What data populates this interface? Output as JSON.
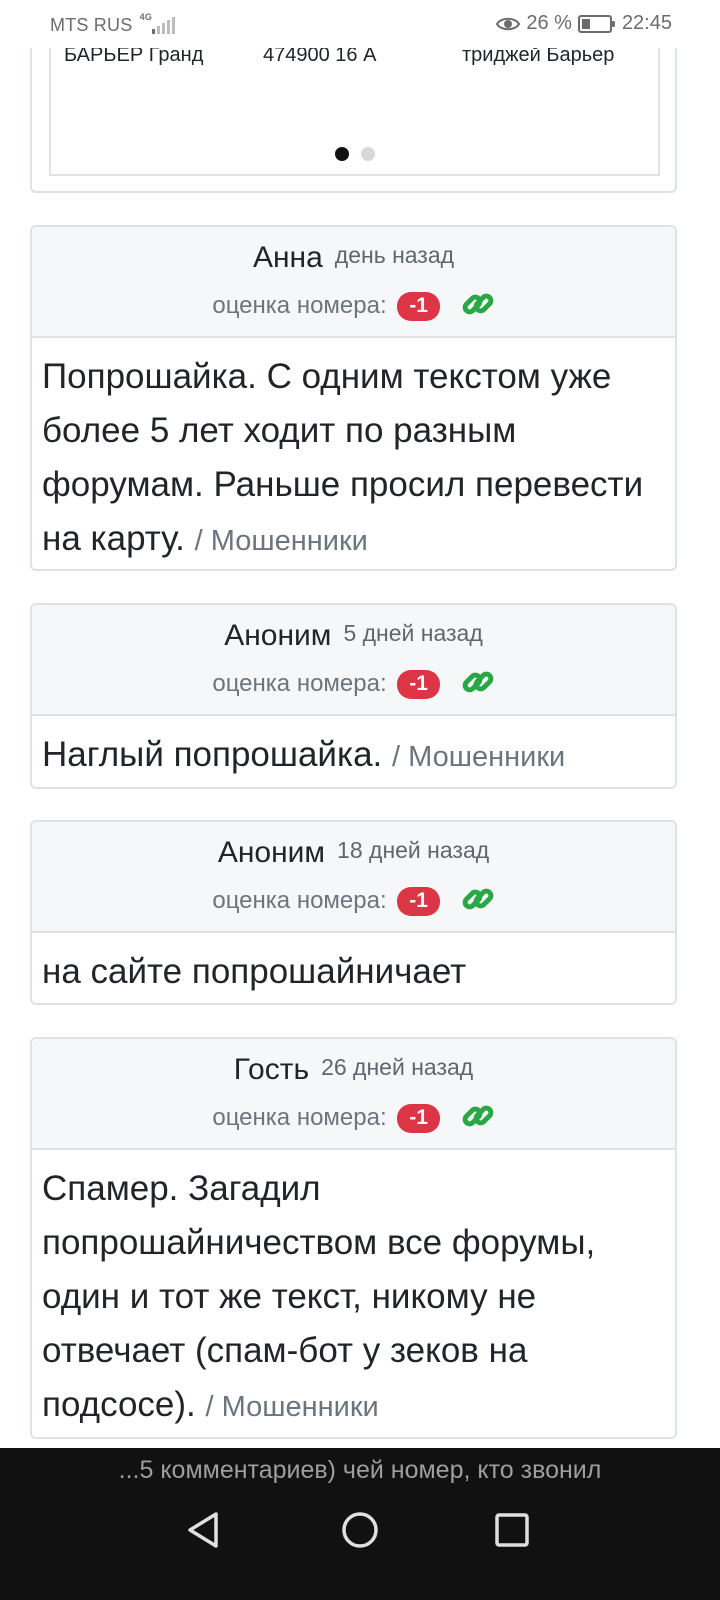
{
  "status_bar": {
    "carrier": "MTS RUS",
    "network": "4G",
    "battery": "26 %",
    "time": "22:45",
    "eye_icon": "eye-icon",
    "battery_icon": "battery-icon"
  },
  "carousel": {
    "cells": [
      "БАРЬЕР Гранд",
      "474900 16 А",
      "триджей Барьер"
    ],
    "active_slide": 1,
    "total_slides": 2
  },
  "score_label": "оценка номера:",
  "comments": [
    {
      "author": "Анна",
      "when": "день назад",
      "score": "-1",
      "text": "Попрошайка. С одним текстом уже более 5 лет ходит по разным форумам. Раньше просил перевести на карту.",
      "category": "/ Мошенники"
    },
    {
      "author": "Аноним",
      "when": "5 дней назад",
      "score": "-1",
      "text": "Наглый попрошайка.",
      "category": "/ Мошенники"
    },
    {
      "author": "Аноним",
      "when": "18 дней назад",
      "score": "-1",
      "text": "на сайте попрошайничает",
      "category": ""
    },
    {
      "author": "Гость",
      "when": "26 дней назад",
      "score": "-1",
      "text": "Спамер. Загадил попрошайничеством все форумы, один и тот же текст, никому не отвечает (спам-бот у зеков на подсосе).",
      "category": "/ Мошенники"
    }
  ],
  "bottom_bar": {
    "page_title": "...5 комментариев) чей номер, кто звонил"
  },
  "colors": {
    "score_badge": "#dc3545",
    "link_icon": "#28a745",
    "header_bg": "#f6f7f8",
    "border": "#dee2e6"
  }
}
